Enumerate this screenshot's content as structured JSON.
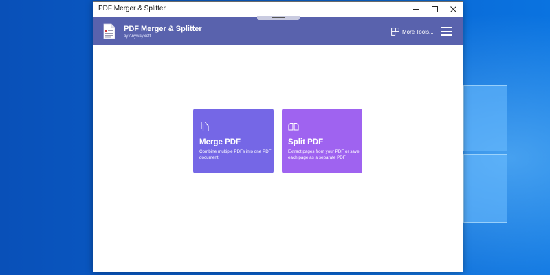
{
  "window": {
    "title": "PDF Merger & Splitter"
  },
  "header": {
    "app_name": "PDF Merger & Splitter",
    "byline": "by AnywaySoft",
    "more_tools_label": "More Tools..."
  },
  "cards": [
    {
      "title": "Merge PDF",
      "description": "Combine multiple PDFs into one PDF document",
      "color": "#7567e6"
    },
    {
      "title": "Split PDF",
      "description": "Extract pages from your PDF or save each page as a separate PDF",
      "color": "#9f63f0"
    }
  ],
  "colors": {
    "header_bg": "#5962ad",
    "desktop_bg": "#0a63cf"
  },
  "icons": {
    "app_logo": "pdf-document-icon",
    "more_tools": "tools-grid-icon",
    "menu": "hamburger-menu-icon",
    "merge": "merge-pages-icon",
    "split": "split-pages-icon"
  }
}
